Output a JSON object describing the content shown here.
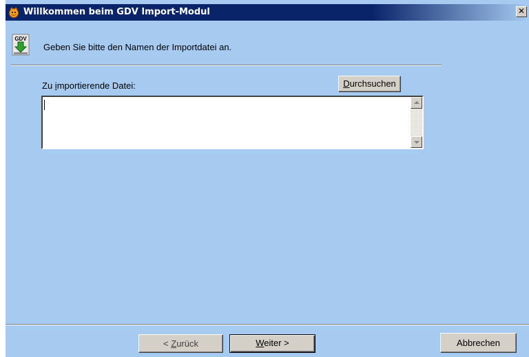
{
  "window": {
    "title": "Willkommen beim GDV Import-Modul",
    "close_label": "✕"
  },
  "header": {
    "instruction": "Geben Sie bitte den Namen der Importdatei an.",
    "icon": "gdv-import-icon"
  },
  "form": {
    "file_label_prefix": "Zu ",
    "file_label_mnemonic": "i",
    "file_label_rest": "mportierende Datei:",
    "browse_mnemonic": "D",
    "browse_rest": "urchsuchen",
    "file_value": ""
  },
  "footer": {
    "back_prefix": "< ",
    "back_mnemonic": "Z",
    "back_rest": "urück",
    "next_mnemonic": "W",
    "next_rest": "eiter >",
    "cancel_label": "Abbrechen"
  },
  "colors": {
    "background": "#a6caf0",
    "titlebar": "#0a246a",
    "button_face": "#d4d0c8"
  }
}
